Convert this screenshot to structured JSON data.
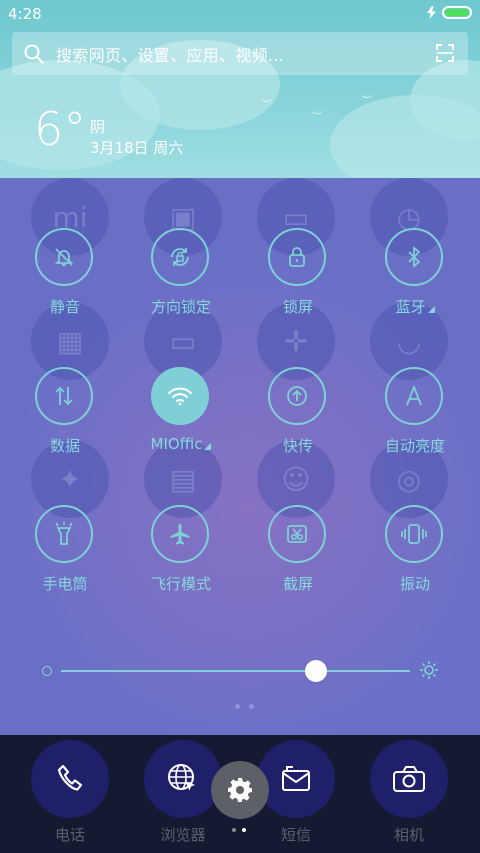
{
  "status_bar": {
    "time": "4:28"
  },
  "search": {
    "placeholder": "搜索网页、设置、应用、视频..."
  },
  "weather": {
    "temp": "6°",
    "condition": "阴",
    "date": "3月18日 周六"
  },
  "toggles": [
    {
      "label": "静音",
      "icon": "bell-off-icon",
      "active": false
    },
    {
      "label": "方向锁定",
      "icon": "rotation-lock-icon",
      "active": false
    },
    {
      "label": "锁屏",
      "icon": "lock-icon",
      "active": false
    },
    {
      "label": "蓝牙",
      "icon": "bluetooth-icon",
      "active": false
    },
    {
      "label": "数据",
      "icon": "mobile-data-icon",
      "active": false
    },
    {
      "label": "MIOffic",
      "icon": "wifi-icon",
      "active": true
    },
    {
      "label": "快传",
      "icon": "share-icon",
      "active": false
    },
    {
      "label": "自动亮度",
      "icon": "auto-brightness-icon",
      "active": false
    },
    {
      "label": "手电筒",
      "icon": "flashlight-icon",
      "active": false
    },
    {
      "label": "飞行模式",
      "icon": "airplane-icon",
      "active": false
    },
    {
      "label": "截屏",
      "icon": "screenshot-icon",
      "active": false
    },
    {
      "label": "振动",
      "icon": "vibrate-icon",
      "active": false
    }
  ],
  "brightness": {
    "level": 0.73
  },
  "dock": [
    {
      "label": "电话",
      "icon": "phone-icon"
    },
    {
      "label": "浏览器",
      "icon": "browser-icon"
    },
    {
      "label": "短信",
      "icon": "message-icon"
    },
    {
      "label": "相机",
      "icon": "camera-icon"
    }
  ],
  "colors": {
    "accent": "#7fd0d6",
    "panel": "#6a6fc6",
    "header": "#86d3d9",
    "battery": "#4ee15e"
  }
}
